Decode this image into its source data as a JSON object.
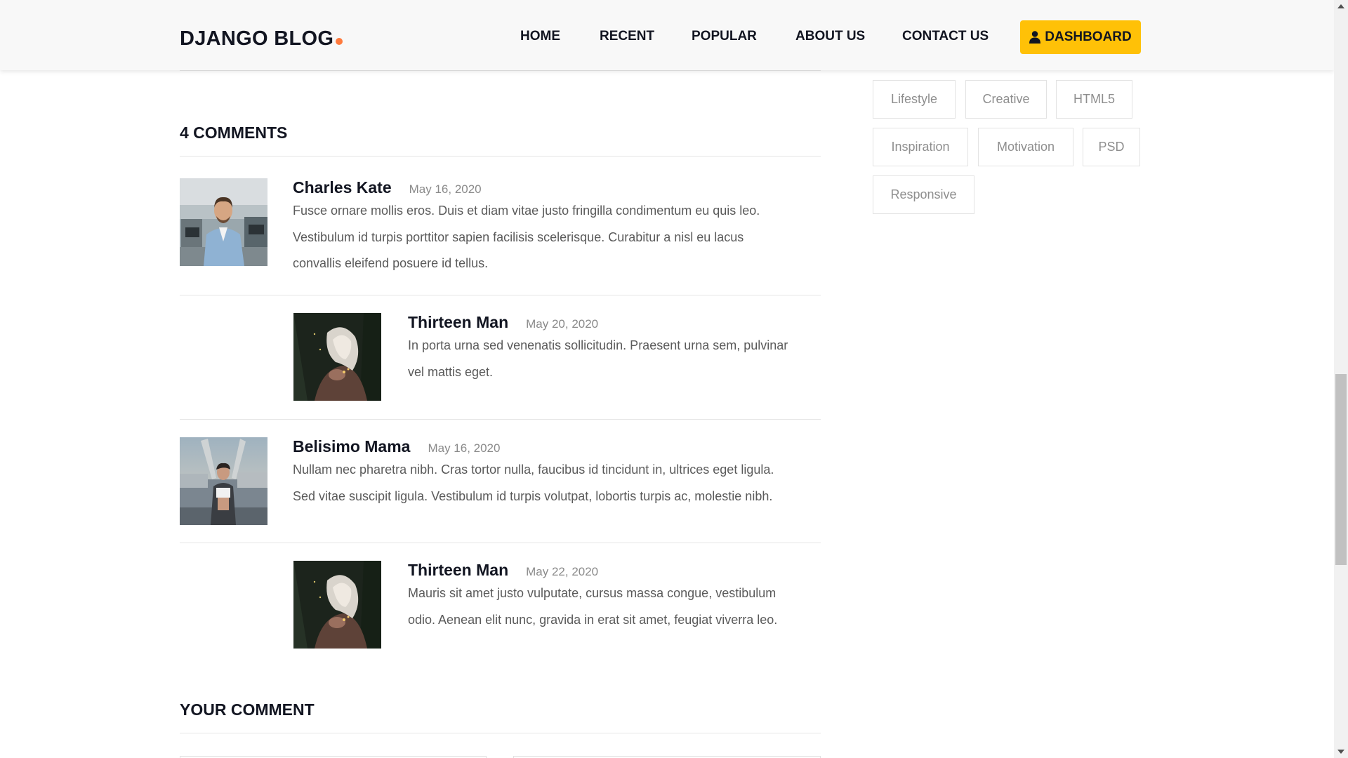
{
  "header": {
    "logo": "DJANGO BLOG",
    "nav": [
      "HOME",
      "RECENT",
      "POPULAR",
      "ABOUT US",
      "CONTACT US"
    ],
    "dashboard_label": "DASHBOARD"
  },
  "comments_section": {
    "title": "4 COMMENTS",
    "comments": [
      {
        "name": "Charles Kate",
        "date": "May 16, 2020",
        "lines": [
          "Fusce ornare mollis eros. Duis et diam vitae justo fringilla condimentum eu quis leo.",
          "Vestibulum id turpis porttitor sapien facilisis scelerisque. Curabitur a nisl eu lacus",
          "convallis eleifend posuere id tellus."
        ],
        "reply": false,
        "avatar": "man-office-photo"
      },
      {
        "name": "Thirteen Man",
        "date": "May 20, 2020",
        "lines": [
          "In porta urna sed venenatis sollicitudin. Praesent urna sem, pulvinar",
          "vel mattis eget."
        ],
        "reply": true,
        "avatar": "woman-dark-portrait"
      },
      {
        "name": "Belisimo Mama",
        "date": "May 16, 2020",
        "lines": [
          "Nullam nec pharetra nibh. Cras tortor nulla, faucibus id tincidunt in, ultrices eget ligula.",
          "Sed vitae suscipit ligula. Vestibulum id turpis volutpat, lobortis turpis ac, molestie nibh."
        ],
        "reply": false,
        "avatar": "woman-stretching-photo"
      },
      {
        "name": "Thirteen Man",
        "date": "May 22, 2020",
        "lines": [
          "Mauris sit amet justo vulputate, cursus massa congue, vestibulum",
          "odio. Aenean elit nunc, gravida in erat sit amet, feugiat viverra leo."
        ],
        "reply": true,
        "avatar": "woman-dark-portrait"
      }
    ]
  },
  "your_comment": {
    "title": "YOUR COMMENT"
  },
  "sidebar": {
    "tags": [
      "Lifestyle",
      "Creative",
      "HTML5",
      "Inspiration",
      "Motivation",
      "PSD",
      "Responsive"
    ]
  },
  "colors": {
    "accent": "#ffc107",
    "logo_dot": "#ff7a3d",
    "text_dark": "#121521",
    "text_body": "#5a5a5a",
    "text_muted": "#8a8a8a",
    "tag_border": "#e3e3e3"
  }
}
